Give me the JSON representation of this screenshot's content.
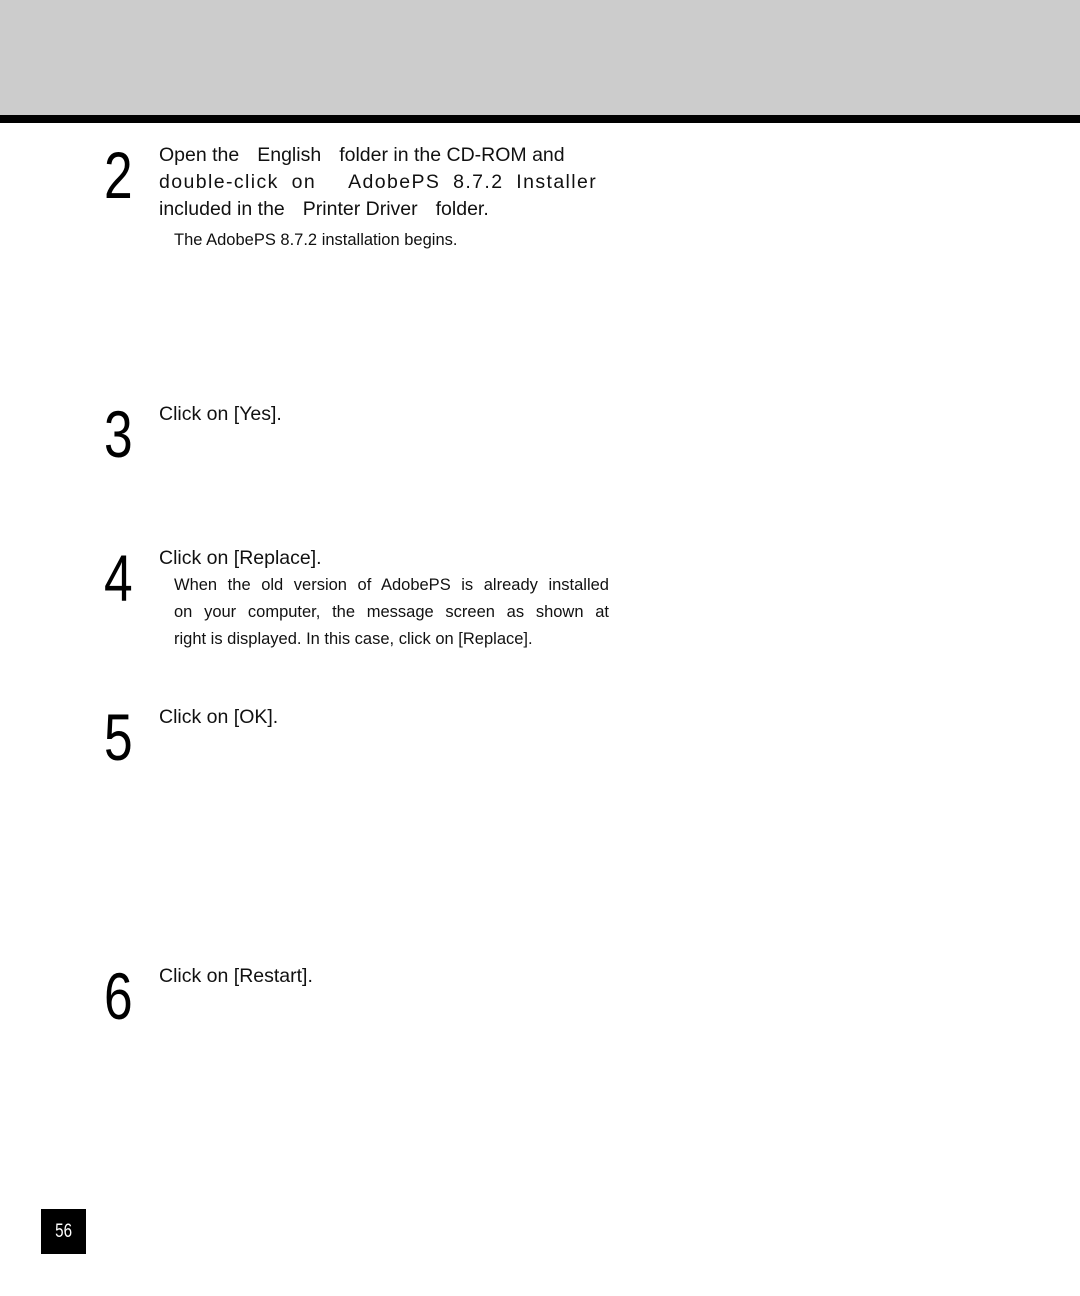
{
  "page": {
    "header_band_color": "#cccccc",
    "header_rule_color": "#000000",
    "page_number": "56"
  },
  "steps": [
    {
      "number": "2",
      "main_parts": {
        "p1": "Open the",
        "p2": "English",
        "p3": "folder in the CD-ROM and",
        "p4": "double-click on",
        "p5": "AdobePS 8.7.2 Installer",
        "p6": "included in the",
        "p7": "Printer Driver",
        "p8": "folder."
      },
      "note_lines": [
        "The AdobePS 8.7.2 installation begins."
      ]
    },
    {
      "number": "3",
      "main": "Click on [Yes].",
      "note_lines": []
    },
    {
      "number": "4",
      "main": "Click on [Replace].",
      "note_lines": [
        "When the old version of AdobePS is already installed",
        "on your computer, the message screen as shown at",
        "right is displayed.  In this case, click on [Replace]."
      ]
    },
    {
      "number": "5",
      "main": "Click on [OK].",
      "note_lines": []
    },
    {
      "number": "6",
      "main": "Click on [Restart].",
      "note_lines": []
    }
  ]
}
